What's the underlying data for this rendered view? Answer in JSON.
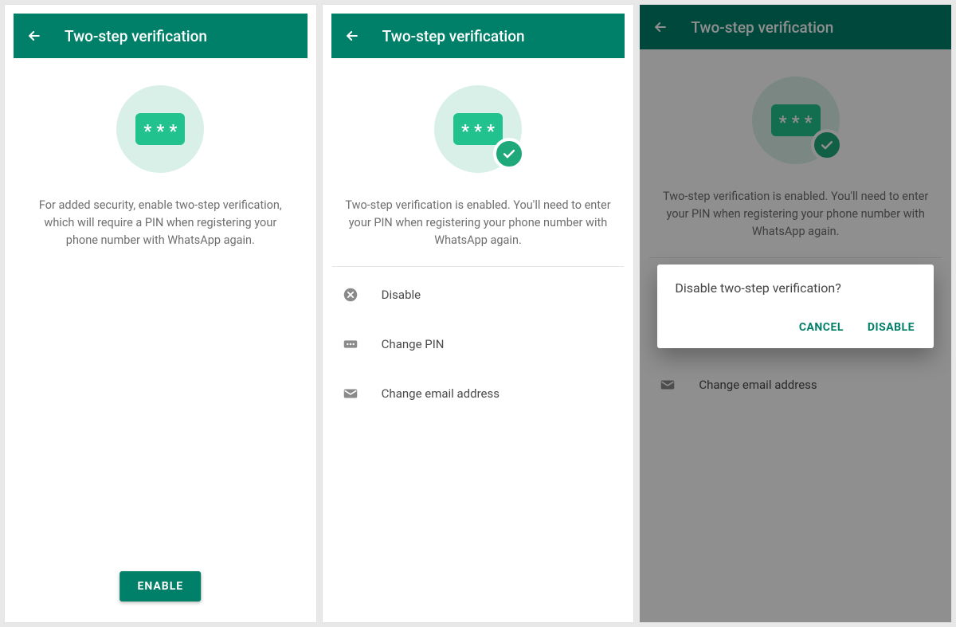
{
  "header": {
    "title": "Two-step verification"
  },
  "screen1": {
    "desc": "For added security, enable two-step verification, which will require a PIN when registering your phone number with WhatsApp again.",
    "enable_label": "ENABLE"
  },
  "screen2": {
    "desc": "Two-step verification is enabled. You'll need to enter your PIN when registering your phone number with WhatsApp again.",
    "items": [
      {
        "label": "Disable"
      },
      {
        "label": "Change PIN"
      },
      {
        "label": "Change email address"
      }
    ]
  },
  "dialog": {
    "title": "Disable two-step verification?",
    "cancel": "CANCEL",
    "confirm": "DISABLE"
  }
}
